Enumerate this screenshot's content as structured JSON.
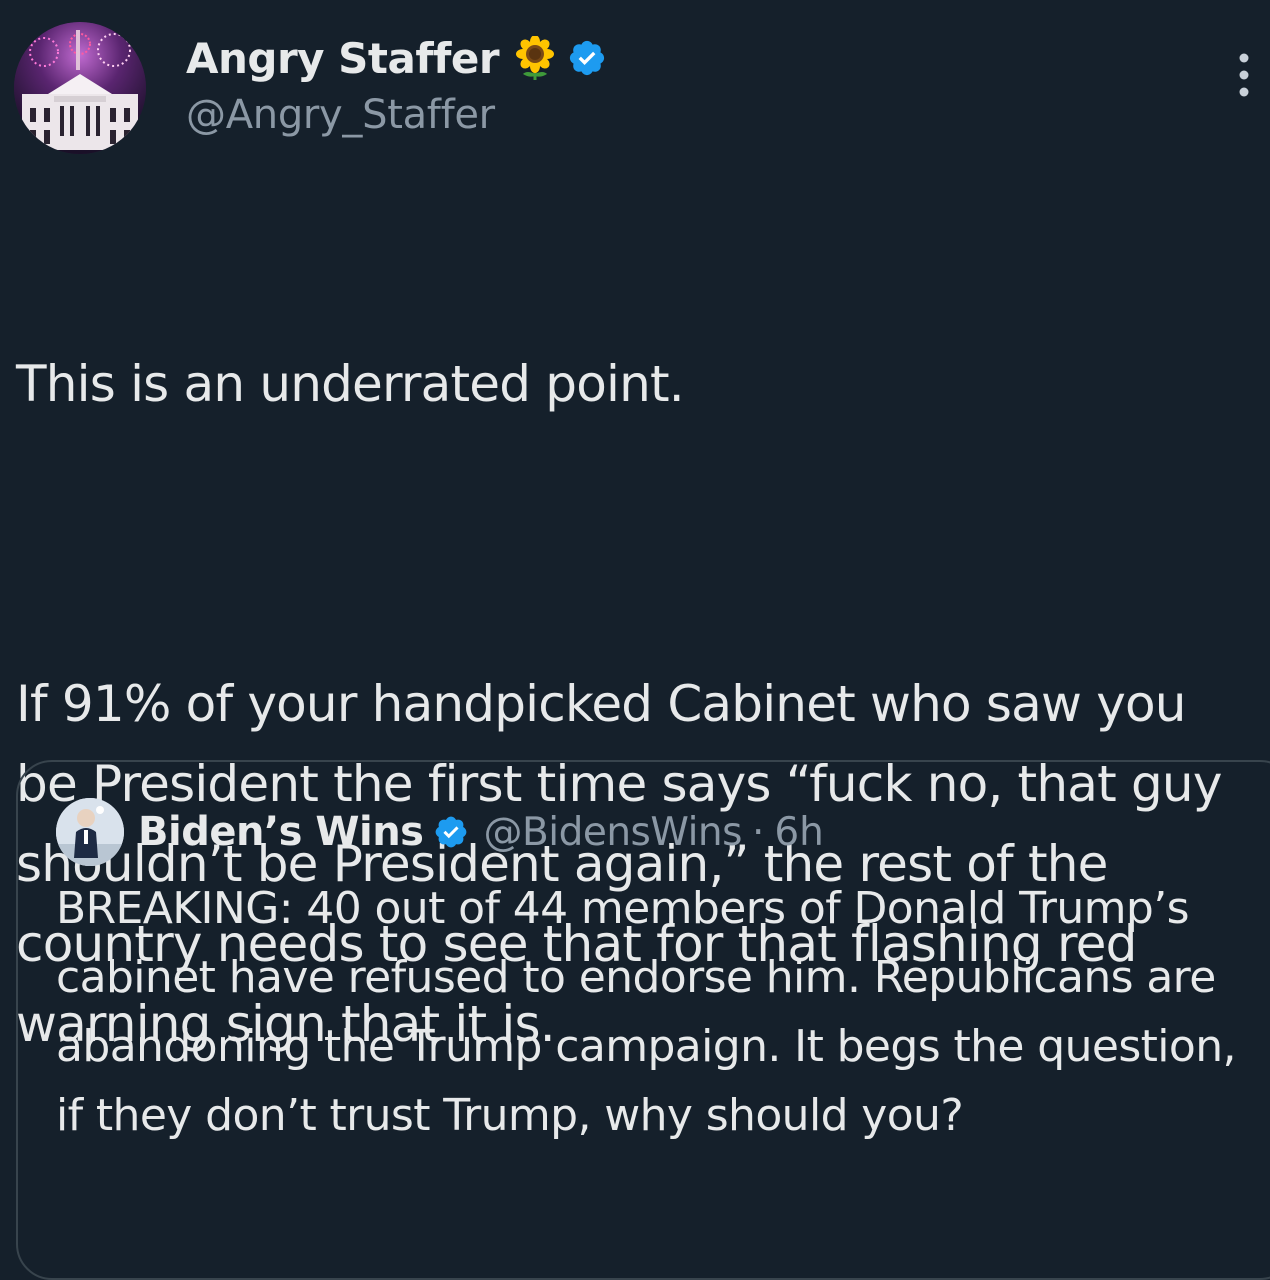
{
  "author": {
    "display_name": "Angry Staffer",
    "handle": "@Angry_Staffer",
    "avatar_icon": "white-house-fireworks-avatar",
    "emoji_icon": "sunflower-icon",
    "verified": true
  },
  "tweet": {
    "paragraphs": [
      "This is an underrated point.",
      "If 91% of your handpicked Cabinet who saw you be President the first time says “fuck no, that guy shouldn’t be President again,” the rest of the country needs to see that for that flashing red warning sign that it is."
    ]
  },
  "quoted_tweet": {
    "display_name": "Biden’s Wins",
    "handle": "@BidensWins",
    "separator": "·",
    "time": "6h",
    "verified": true,
    "text": "BREAKING: 40 out of 44 members of Donald Trump’s cabinet have refused to endorse him. Republicans are abandoning the Trump campaign. It begs the question, if they don’t trust Trump, why should you?"
  },
  "colors": {
    "background": "#15202b",
    "text_primary": "#e7e9ea",
    "text_secondary": "#8b98a5",
    "verified_blue": "#1d9bf0",
    "border": "#38444d"
  }
}
